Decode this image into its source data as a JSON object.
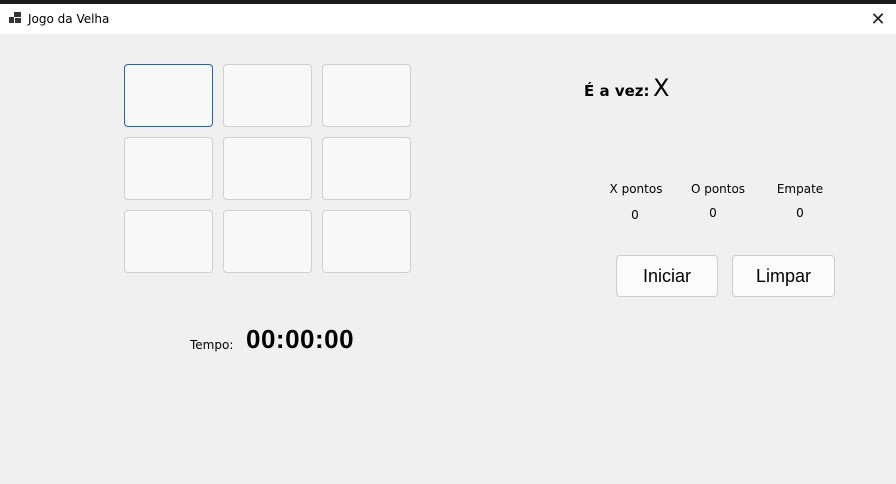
{
  "window": {
    "title": "Jogo da Velha",
    "close_glyph": "✕"
  },
  "board": {
    "cells": [
      "",
      "",
      "",
      "",
      "",
      "",
      "",
      "",
      ""
    ]
  },
  "turn": {
    "label": "É a vez:",
    "player": "X"
  },
  "score": {
    "x_label": "X pontos",
    "x_value": "0",
    "o_label": "O pontos",
    "o_value": "0",
    "draw_label": "Empate",
    "draw_value": "0"
  },
  "buttons": {
    "start": "Iniciar",
    "clear": "Limpar"
  },
  "timer": {
    "label": "Tempo:",
    "value": "00:00:00"
  }
}
